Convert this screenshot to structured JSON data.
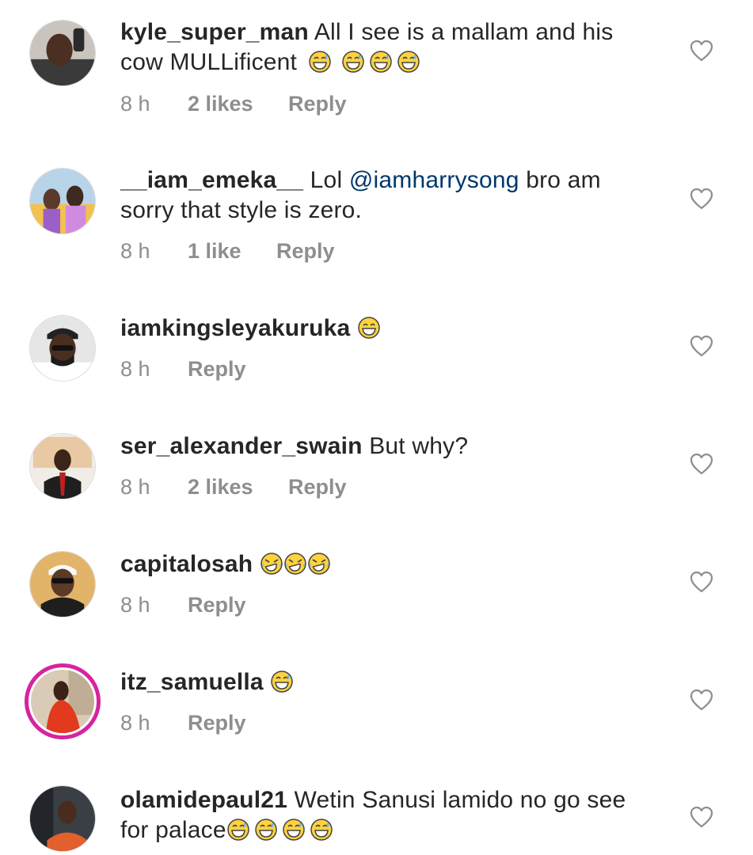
{
  "colors": {
    "text": "#262626",
    "meta": "#8e8e8e",
    "mention": "#00376b",
    "story_ring": "#d6249f"
  },
  "comments": [
    {
      "username": "kyle_super_man",
      "text": " All I see is a mallam and his cow  MULLificent ",
      "emoji": [
        "grinning-sweat",
        "grinning-sweat",
        "grinning-sweat",
        "grinning-sweat"
      ],
      "time": "8 h",
      "likes": "2 likes",
      "reply": "Reply"
    },
    {
      "username": "__iam_emeka__",
      "text_before": " Lol ",
      "mention": "@iamharrysong",
      "text_after": " bro am sorry that style is zero.",
      "time": "8 h",
      "likes": "1 like",
      "reply": "Reply"
    },
    {
      "username": "iamkingsleyakuruka",
      "text": " ",
      "emoji": [
        "grinning"
      ],
      "time": "8 h",
      "reply": "Reply"
    },
    {
      "username": "ser_alexander_swain",
      "text": " But why?",
      "time": "8 h",
      "likes": "2 likes",
      "reply": "Reply"
    },
    {
      "username": "capitalosah",
      "text": " ",
      "emoji": [
        "rofl",
        "rofl",
        "rofl"
      ],
      "time": "8 h",
      "reply": "Reply"
    },
    {
      "username": "itz_samuella",
      "text": " ",
      "emoji": [
        "grinning-sweat"
      ],
      "time": "8 h",
      "reply": "Reply"
    },
    {
      "username": "olamidepaul21",
      "text": " Wetin Sanusi lamido no go see for palace",
      "emoji": [
        "grinning-sweat",
        "grinning-sweat",
        "grinning-sweat",
        "grinning-sweat"
      ]
    }
  ]
}
